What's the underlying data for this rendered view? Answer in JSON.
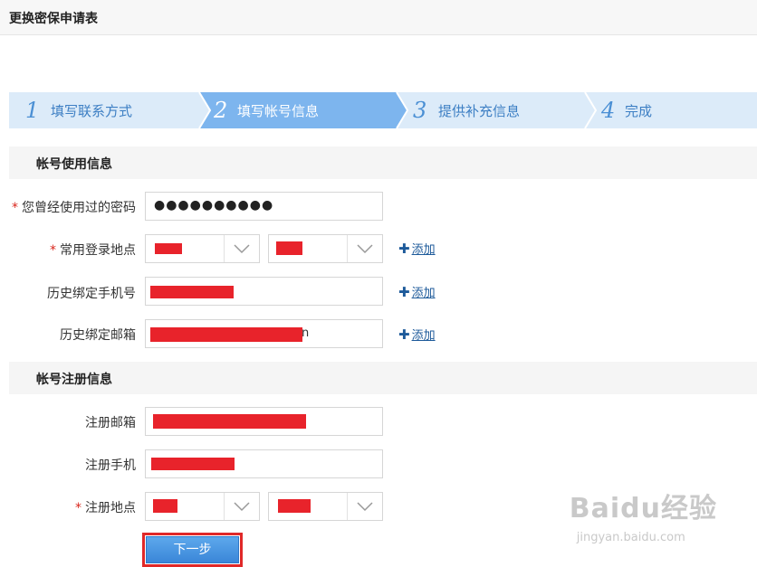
{
  "page": {
    "title": "更换密保申请表"
  },
  "steps": [
    {
      "num": "1",
      "label": "填写联系方式"
    },
    {
      "num": "2",
      "label": "填写帐号信息"
    },
    {
      "num": "3",
      "label": "提供补充信息"
    },
    {
      "num": "4",
      "label": "完成"
    }
  ],
  "sections": {
    "usage": "帐号使用信息",
    "register": "帐号注册信息"
  },
  "fields": {
    "password_label": "您曾经使用过的密码",
    "password_value": "●●●●●●●●●●",
    "location_label": "常用登录地点",
    "phone_history_label": "历史绑定手机号",
    "email_history_label": "历史绑定邮箱",
    "email_history_tail": "n",
    "reg_email_label": "注册邮箱",
    "reg_phone_label": "注册手机",
    "reg_location_label": "注册地点",
    "required_mark": "*"
  },
  "add_link": "添加",
  "next_button": "下一步",
  "watermark": {
    "big": "Baidu经验",
    "small": "jingyan.baidu.com"
  },
  "colors": {
    "active_step": "#7db5ee",
    "inactive_step": "#dcebf9",
    "redaction": "#e8232b"
  }
}
